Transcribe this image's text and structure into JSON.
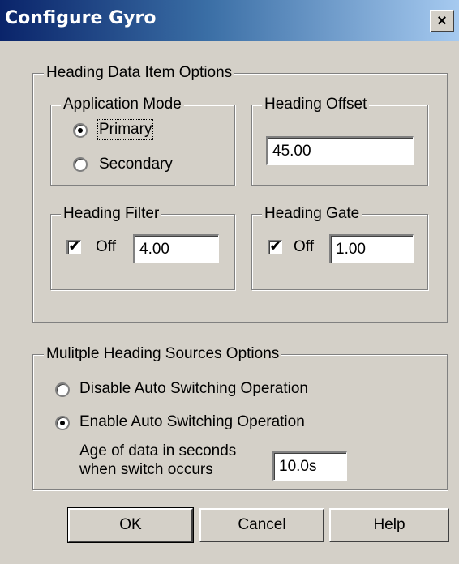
{
  "window": {
    "title": "Configure Gyro",
    "close_label": "×"
  },
  "heading_data": {
    "legend": "Heading Data Item Options",
    "application_mode": {
      "legend": "Application Mode",
      "options": [
        "Primary",
        "Secondary"
      ],
      "selected": "Primary"
    },
    "heading_offset": {
      "legend": "Heading Offset",
      "value": "45.00"
    },
    "heading_filter": {
      "legend": "Heading Filter",
      "checkbox_label": "Off",
      "checked": true,
      "value": "4.00"
    },
    "heading_gate": {
      "legend": "Heading Gate",
      "checkbox_label": "Off",
      "checked": true,
      "value": "1.00"
    }
  },
  "multiple_sources": {
    "legend": "Mulitple Heading Sources Options",
    "options": [
      "Disable Auto Switching Operation",
      "Enable Auto Switching Operation"
    ],
    "selected": "Enable Auto Switching Operation",
    "age_label_line1": "Age of data in seconds",
    "age_label_line2": "when switch occurs",
    "age_value": "10.0s"
  },
  "buttons": {
    "ok": "OK",
    "cancel": "Cancel",
    "help": "Help"
  },
  "check_mark": "✔"
}
